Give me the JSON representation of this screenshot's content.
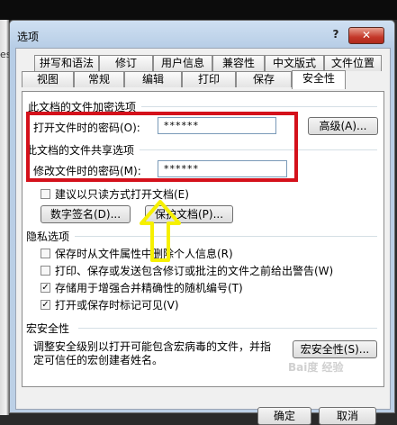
{
  "window": {
    "title": "选项",
    "help": "?",
    "close": "✕"
  },
  "desktop": {
    "edge_text": "es"
  },
  "tabs_row1": [
    "拼写和语法",
    "修订",
    "用户信息",
    "兼容性",
    "中文版式",
    "文件位置"
  ],
  "tabs_row2": [
    "视图",
    "常规",
    "编辑",
    "打印",
    "保存",
    "安全性"
  ],
  "encrypt": {
    "header": "此文档的文件加密选项",
    "label": "打开文件时的密码(O):",
    "value": "******",
    "advanced": "高级(A)..."
  },
  "share": {
    "header": "此文档的文件共享选项",
    "label": "修改文件时的密码(M):",
    "value": "******",
    "readonly": "建议以只读方式打开文档(E)",
    "digital_sign": "数字签名(D)...",
    "protect": "保护文档(P)..."
  },
  "privacy": {
    "header": "隐私选项",
    "items": [
      {
        "label": "保存时从文件属性中删除个人信息(R)",
        "checked": false
      },
      {
        "label": "打印、保存或发送包含修订或批注的文件之前给出警告(W)",
        "checked": false
      },
      {
        "label": "存储用于增强合并精确性的随机编号(T)",
        "checked": true
      },
      {
        "label": "打开或保存时标记可见(V)",
        "checked": true
      }
    ]
  },
  "macro": {
    "header": "宏安全性",
    "line1": "调整安全级别以打开可能包含宏病毒的文件，并指",
    "line2": "定可信任的宏创建者姓名。",
    "button": "宏安全性(S)..."
  },
  "footer": {
    "ok": "确定",
    "cancel": "取消"
  },
  "watermark": "Bai度 经验",
  "colors": {
    "highlight_box": "#d4111b",
    "arrow": "#f6f000"
  }
}
